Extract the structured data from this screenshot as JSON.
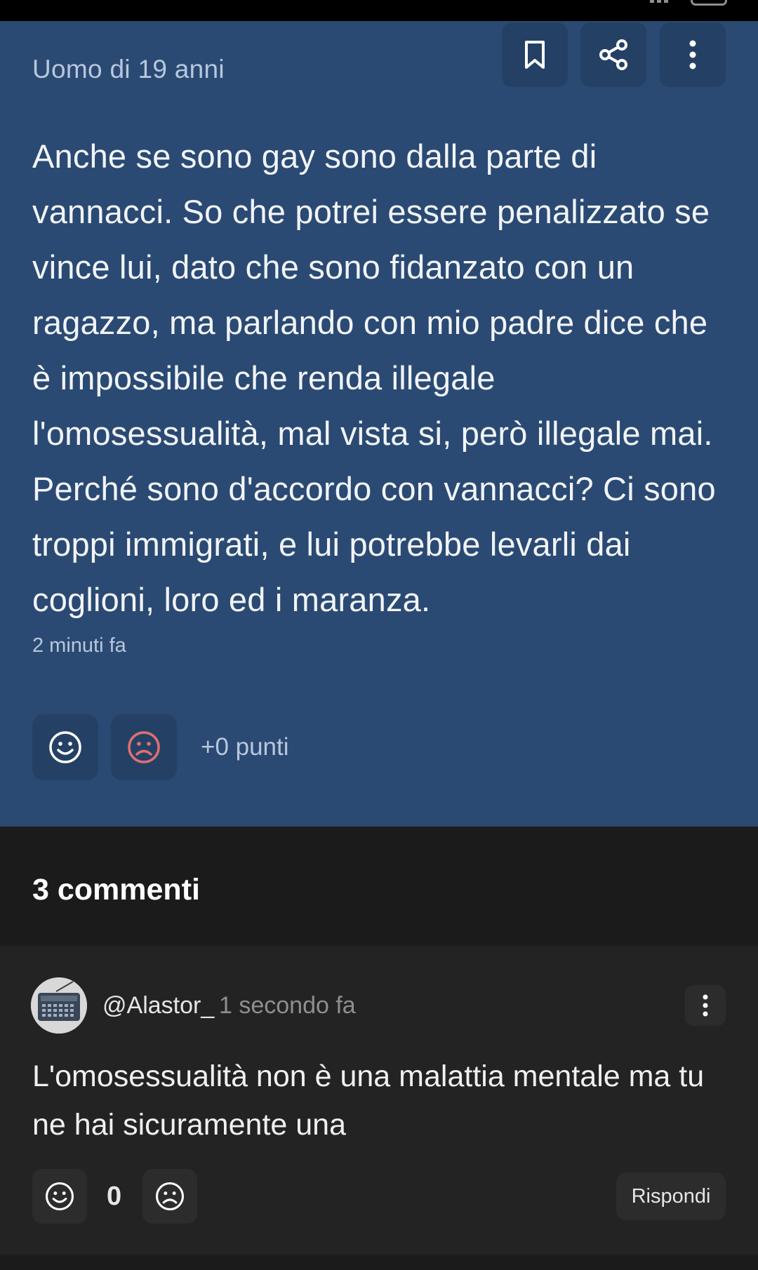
{
  "post": {
    "author": "Uomo di 19 anni",
    "text": "Anche se sono gay sono dalla parte di vannacci. So che potrei essere penalizzato se vince lui, dato che sono fidanzato con un ragazzo, ma parlando con mio padre dice che è impossibile che renda illegale l'omosessualità, mal vista si, però illegale mai. Perché sono d'accordo con vannacci? Ci sono troppi immigrati, e lui potrebbe levarli dai coglioni, loro ed i maranza.",
    "time": "2 minuti fa",
    "points": "+0 punti",
    "icons": {
      "bookmark": "bookmark-icon",
      "share": "share-icon",
      "more": "more-vertical-icon",
      "upvote": "smile-icon",
      "downvote": "frown-icon"
    }
  },
  "comments": {
    "title": "3 commenti",
    "items": [
      {
        "user": "@Alastor_",
        "time": "1 secondo fa",
        "text": "L'omosessualità non è una malattia mentale ma tu ne hai sicuramente una",
        "score": "0",
        "reply_label": "Rispondi",
        "avatar_icon": "radio-avatar"
      }
    ]
  },
  "colors": {
    "post_bg": "#2a4a73",
    "post_button_bg": "#244165",
    "downvote_accent": "#e07070",
    "page_bg": "#1c1c1e",
    "comment_bg": "#232323"
  }
}
